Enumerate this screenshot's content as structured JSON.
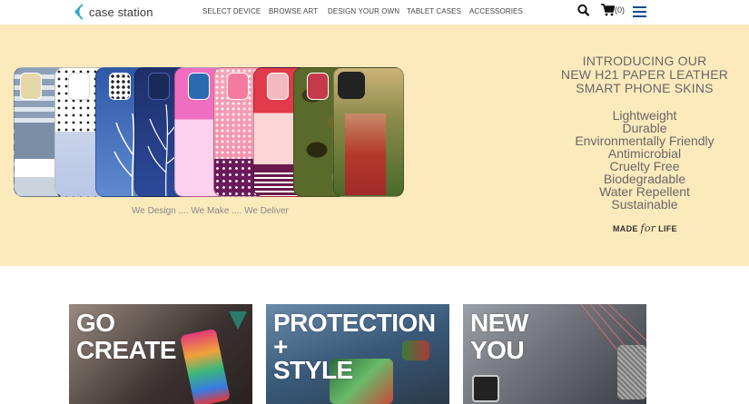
{
  "brand": {
    "name": "case station"
  },
  "nav": [
    "SELECT DEVICE",
    "BROWSE ART",
    "DESIGN YOUR OWN",
    "TABLET CASES",
    "ACCESSORIES"
  ],
  "header_icons": {
    "search": "search-icon",
    "cart": "cart-icon",
    "cart_count": "(0)",
    "menu": "hamburger-menu-icon"
  },
  "hero": {
    "tagline": "We Design .... We Make .... We Deliver",
    "heading": [
      "INTRODUCING OUR",
      "NEW H21 PAPER LEATHER",
      "SMART PHONE SKINS"
    ],
    "features": [
      "Lightweight",
      "Durable",
      "Environmentally Friendly",
      "Antimicrobial",
      "Cruelty Free",
      "Biodegradable",
      "Water Repellent",
      "Sustainable"
    ],
    "badge": {
      "pre": "MADE ",
      "script": "for",
      "post": " LIFE"
    }
  },
  "cards": [
    {
      "lines": [
        "GO",
        "CREATE"
      ]
    },
    {
      "lines": [
        "PROTECTION",
        "+",
        "STYLE"
      ]
    },
    {
      "lines": [
        "NEW",
        "YOU"
      ]
    }
  ],
  "colors": {
    "hero_bg": "#fdeabc",
    "nav_accent": "#1a4a8a"
  }
}
